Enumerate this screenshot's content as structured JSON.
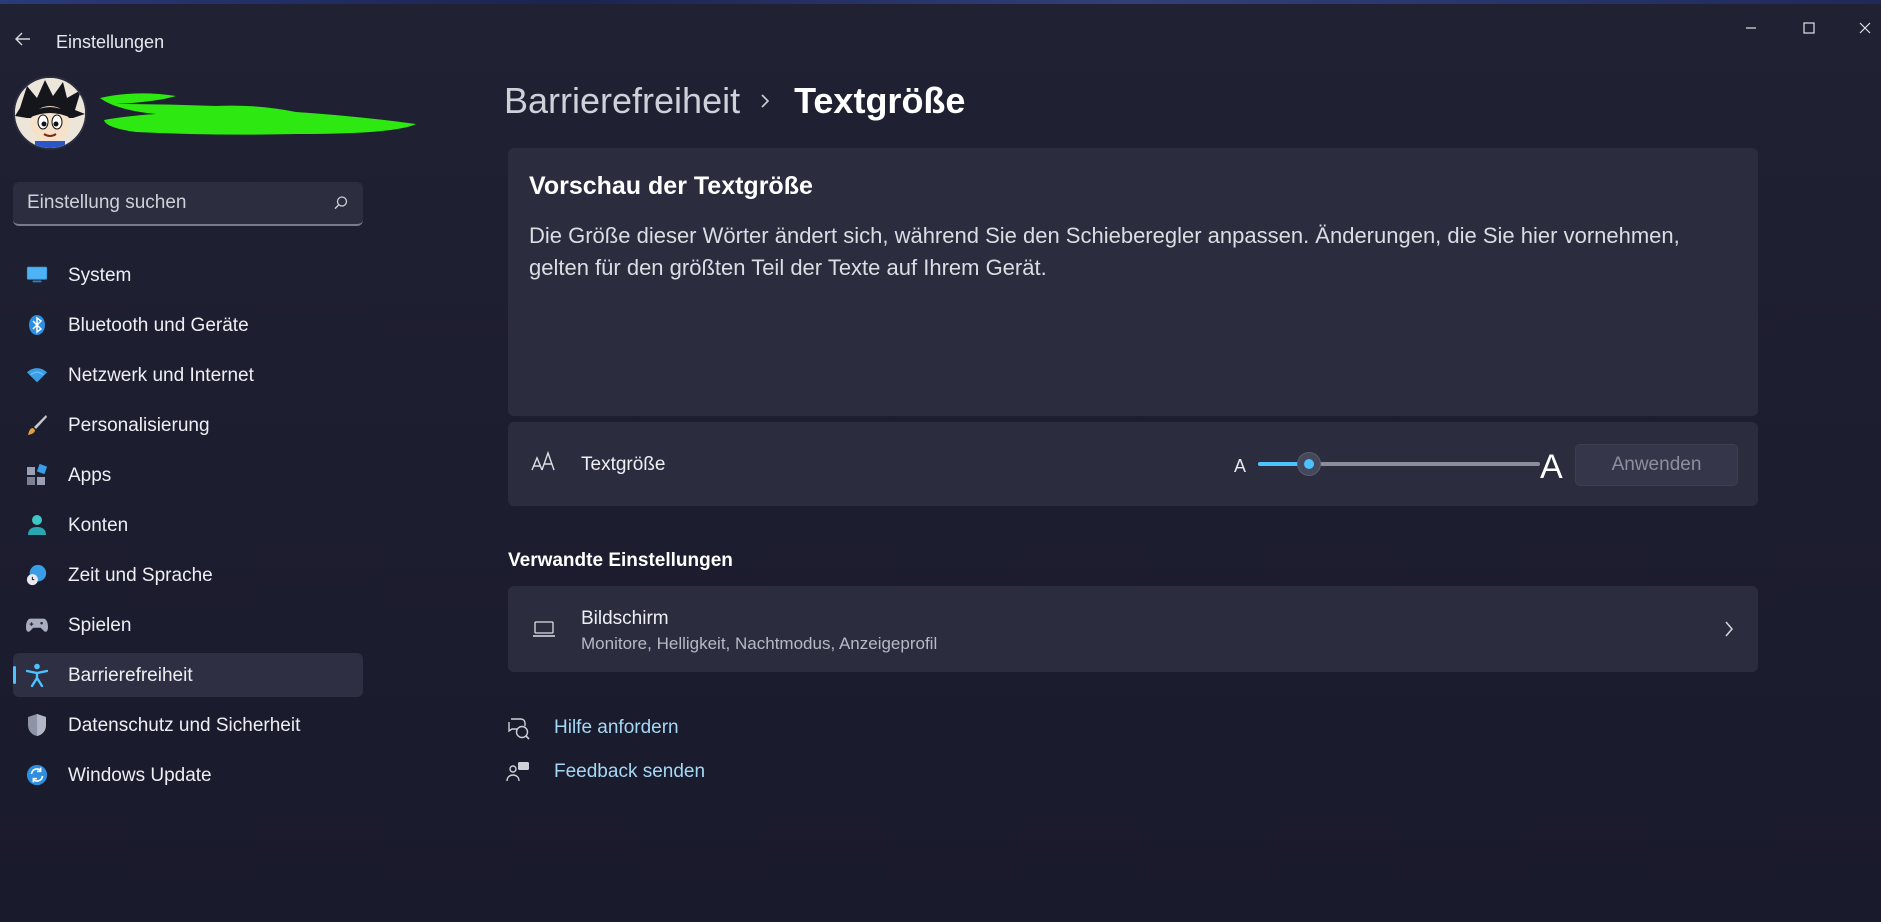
{
  "app": {
    "title": "Einstellungen"
  },
  "search": {
    "placeholder": "Einstellung suchen"
  },
  "sidebar": {
    "items": [
      {
        "label": "System",
        "icon": "monitor-icon"
      },
      {
        "label": "Bluetooth und Geräte",
        "icon": "bluetooth-icon"
      },
      {
        "label": "Netzwerk und Internet",
        "icon": "wifi-icon"
      },
      {
        "label": "Personalisierung",
        "icon": "brush-icon"
      },
      {
        "label": "Apps",
        "icon": "apps-icon"
      },
      {
        "label": "Konten",
        "icon": "person-icon"
      },
      {
        "label": "Zeit und Sprache",
        "icon": "globe-clock-icon"
      },
      {
        "label": "Spielen",
        "icon": "gamepad-icon"
      },
      {
        "label": "Barrierefreiheit",
        "icon": "accessibility-icon",
        "active": true
      },
      {
        "label": "Datenschutz und Sicherheit",
        "icon": "shield-icon"
      },
      {
        "label": "Windows Update",
        "icon": "update-icon"
      }
    ]
  },
  "breadcrumb": {
    "parent": "Barrierefreiheit",
    "current": "Textgröße"
  },
  "preview": {
    "title": "Vorschau der Textgröße",
    "text": "Die Größe dieser Wörter ändert sich, während Sie den Schieberegler anpassen. Änderungen, die Sie hier vornehmen, gelten für den größten Teil der Texte auf Ihrem Gerät."
  },
  "text_size": {
    "label": "Textgröße",
    "small_a": "A",
    "big_a": "A",
    "slider_value_fraction": 0.18,
    "apply_label": "Anwenden"
  },
  "related": {
    "title": "Verwandte Einstellungen",
    "display": {
      "title": "Bildschirm",
      "subtitle": "Monitore, Helligkeit, Nachtmodus, Anzeigeprofil"
    }
  },
  "help": {
    "get_help": "Hilfe anfordern",
    "feedback": "Feedback senden"
  },
  "colors": {
    "accent": "#4cc2ff",
    "link": "#a5d8f5",
    "redaction": "#2ee812"
  }
}
